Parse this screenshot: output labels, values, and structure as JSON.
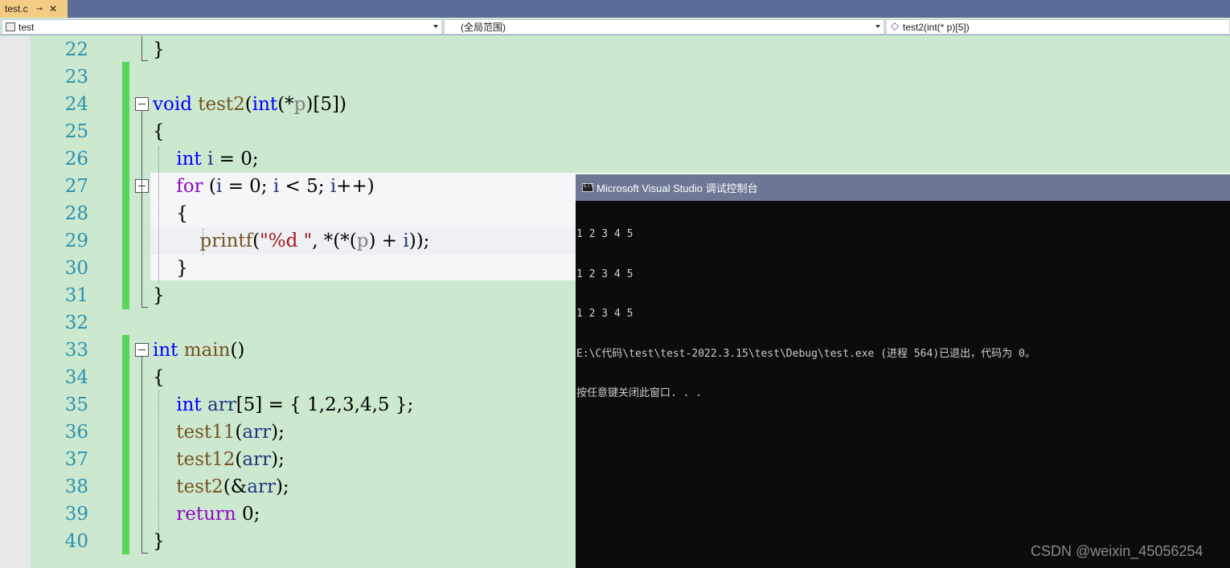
{
  "tab": {
    "title": "test.c",
    "pin": "⊸",
    "close": "✕"
  },
  "nav": {
    "project": "test",
    "scope": "(全局范围)",
    "member": "test2(int(* p)[5])"
  },
  "lines": [
    {
      "num": "22",
      "code": "}"
    },
    {
      "num": "23",
      "code": ""
    },
    {
      "num": "24",
      "code": "void test2(int(*p)[5])"
    },
    {
      "num": "25",
      "code": "{"
    },
    {
      "num": "26",
      "code": "    int i = 0;"
    },
    {
      "num": "27",
      "code": "    for (i = 0; i < 5; i++)"
    },
    {
      "num": "28",
      "code": "    {"
    },
    {
      "num": "29",
      "code": "        printf(\"%d \", *(*(p) + i));"
    },
    {
      "num": "30",
      "code": "    }"
    },
    {
      "num": "31",
      "code": "}"
    },
    {
      "num": "32",
      "code": ""
    },
    {
      "num": "33",
      "code": "int main()"
    },
    {
      "num": "34",
      "code": "{"
    },
    {
      "num": "35",
      "code": "    int arr[5] = { 1,2,3,4,5 };"
    },
    {
      "num": "36",
      "code": "    test11(arr);"
    },
    {
      "num": "37",
      "code": "    test12(arr);"
    },
    {
      "num": "38",
      "code": "    test2(&arr);"
    },
    {
      "num": "39",
      "code": "    return 0;"
    },
    {
      "num": "40",
      "code": "}"
    }
  ],
  "console": {
    "title": "Microsoft Visual Studio 调试控制台",
    "output": [
      "1 2 3 4 5",
      "1 2 3 4 5",
      "1 2 3 4 5",
      "E:\\C代码\\test\\test-2022.3.15\\test\\Debug\\test.exe (进程 564)已退出，代码为 0。",
      "按任意键关闭此窗口. . ."
    ]
  },
  "watermark": "CSDN @weixin_45056254",
  "colors": {
    "keyword": "#0000ff",
    "control": "#8f08c4",
    "function": "#74531f",
    "string": "#a31515",
    "line_number": "#2b91af",
    "change_bar": "#57d65b",
    "editor_bg": "#cce8cf"
  }
}
